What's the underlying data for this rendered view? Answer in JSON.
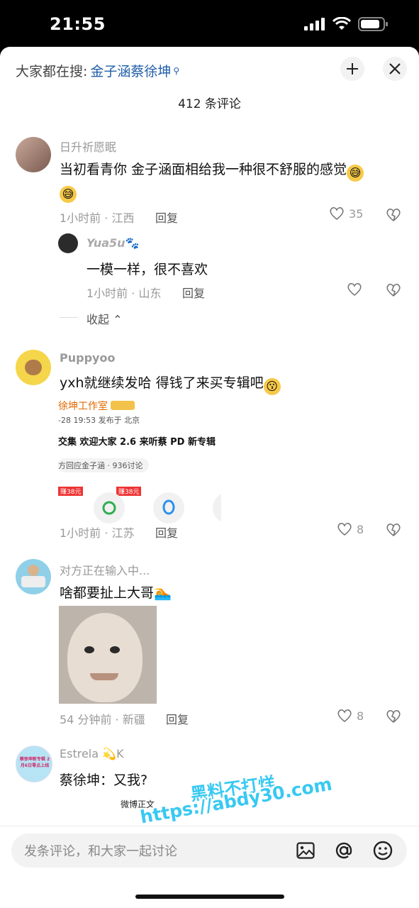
{
  "status_bar": {
    "time": "21:55"
  },
  "header": {
    "search_prefix": "大家都在搜:",
    "search_keyword": "金子涵蔡徐坤",
    "comment_count": "412 条评论"
  },
  "comments": [
    {
      "username": "日升祈愿眠",
      "text_line1": "当初看青你 金子涵面相给我一种很不舒服的感觉",
      "meta": "1小时前 · 江西",
      "reply_label": "回复",
      "likes": "35",
      "reply": {
        "username": "Yua5u",
        "text": "一模一样，很不喜欢",
        "meta": "1小时前 · 山东",
        "reply_label": "回复"
      },
      "collapse_label": "收起"
    },
    {
      "username": "Puppyoo",
      "text": "yxh就继续发哈 得钱了来买专辑吧",
      "meta": "1小时前 · 江苏",
      "reply_label": "回复",
      "likes": "8",
      "image_card": {
        "line1": "徐坤工作室",
        "line2": "-28 19:53  发布于 北京",
        "line3": "交集 欢迎大家 2.6 来听蔡 PD 新专辑",
        "line4": "方回应金子涵 · 936讨论",
        "badge1": "赚38元",
        "badge2": "赚38元"
      }
    },
    {
      "username": "对方正在输入中...",
      "text": "啥都要扯上大哥",
      "meta": "54 分钟前 · 新疆",
      "reply_label": "回复",
      "likes": "8"
    },
    {
      "username": "Estrela",
      "username_suffix": "K",
      "text": "蔡徐坤：又我?",
      "card_snippet": "微博正文",
      "avatar_text": "蔡徐坤新专辑 2月6日零点上线"
    }
  ],
  "composer": {
    "placeholder": "发条评论，和大家一起讨论"
  },
  "watermark": {
    "line1": "黑料不打烊",
    "line2": "https://abdy30.com"
  },
  "colors": {
    "keyword": "#1f5ea8",
    "watermark": "#38c9f2"
  }
}
